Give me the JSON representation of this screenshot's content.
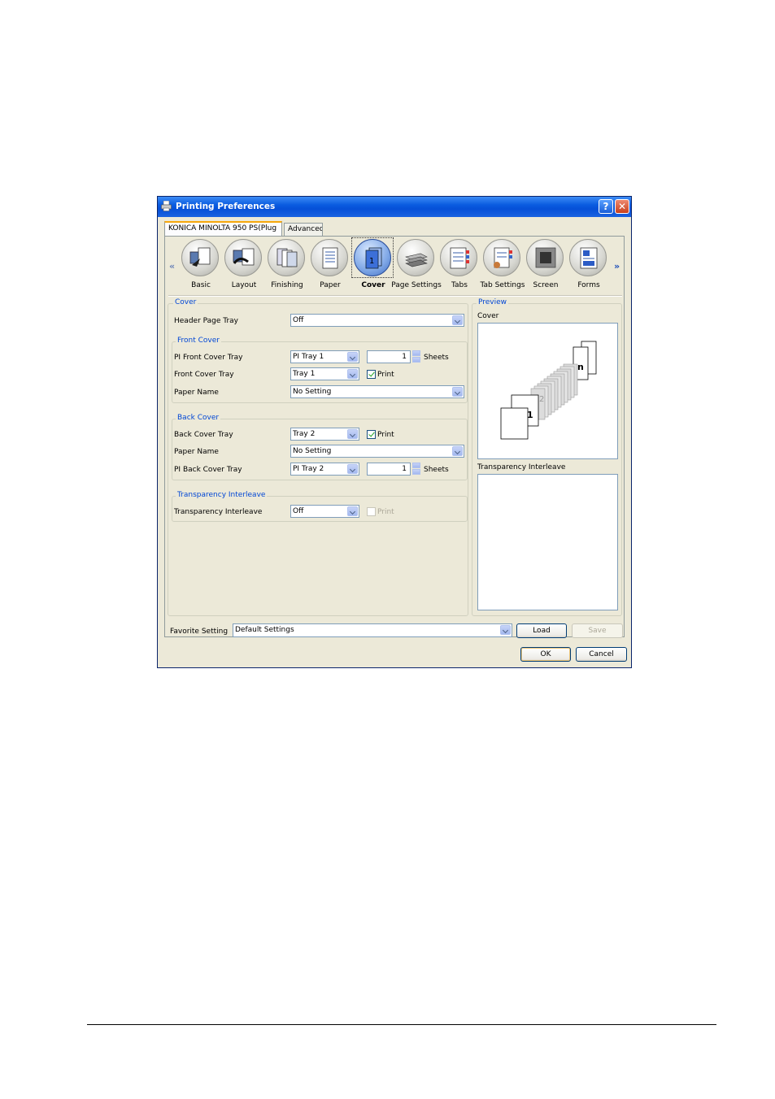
{
  "window": {
    "title": "Printing Preferences",
    "help_label": "?",
    "close_label": "✕"
  },
  "tabs": [
    {
      "label": "KONICA MINOLTA 950 PS(Plug"
    },
    {
      "label": "Advanced"
    }
  ],
  "toolbar": {
    "items": [
      {
        "label": "Basic",
        "icon": "basic-icon"
      },
      {
        "label": "Layout",
        "icon": "layout-icon"
      },
      {
        "label": "Finishing",
        "icon": "finishing-icon"
      },
      {
        "label": "Paper",
        "icon": "paper-icon"
      },
      {
        "label": "Cover",
        "icon": "cover-icon",
        "selected": true
      },
      {
        "label": "Page Settings",
        "icon": "page-settings-icon"
      },
      {
        "label": "Tabs",
        "icon": "tabs-icon"
      },
      {
        "label": "Tab Settings",
        "icon": "tab-settings-icon"
      },
      {
        "label": "Screen",
        "icon": "screen-icon"
      },
      {
        "label": "Forms",
        "icon": "forms-icon"
      }
    ],
    "prev_label": "«",
    "next_label": "»"
  },
  "cover": {
    "legend": "Cover",
    "header_page_tray_label": "Header Page Tray",
    "header_page_tray_value": "Off",
    "front": {
      "legend": "Front Cover",
      "pi_tray_label": "PI Front Cover Tray",
      "pi_tray_value": "PI Tray 1",
      "sheets_value": "1",
      "sheets_label": "Sheets",
      "tray_label": "Front Cover Tray",
      "tray_value": "Tray 1",
      "print_label": "Print",
      "paper_name_label": "Paper Name",
      "paper_name_value": "No Setting"
    },
    "back": {
      "legend": "Back Cover",
      "tray_label": "Back Cover Tray",
      "tray_value": "Tray 2",
      "print_label": "Print",
      "paper_name_label": "Paper Name",
      "paper_name_value": "No Setting",
      "pi_tray_label": "PI Back Cover Tray",
      "pi_tray_value": "PI Tray 2",
      "sheets_value": "1",
      "sheets_label": "Sheets"
    },
    "transparency": {
      "legend": "Transparency Interleave",
      "label": "Transparency Interleave",
      "value": "Off",
      "print_label": "Print"
    }
  },
  "preview": {
    "legend": "Preview",
    "cover_label": "Cover",
    "page_first": "1",
    "page_second": "2",
    "page_last": "n",
    "transparency_label": "Transparency Interleave"
  },
  "favorite": {
    "label": "Favorite Setting",
    "value": "Default Settings",
    "load_label": "Load",
    "save_label": "Save"
  },
  "buttons": {
    "ok_label": "OK",
    "cancel_label": "Cancel"
  }
}
